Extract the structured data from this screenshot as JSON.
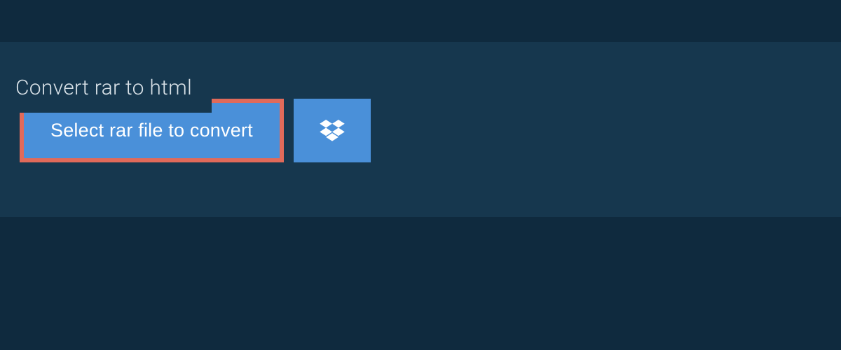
{
  "tab": {
    "title": "Convert rar to html"
  },
  "actions": {
    "select_label": "Select rar file to convert",
    "dropbox_icon_name": "dropbox-icon"
  },
  "colors": {
    "background_dark": "#0f2a3e",
    "background": "#16374e",
    "button": "#4a90d9",
    "button_border": "#e06a5a",
    "text_light": "#d9e2e8",
    "text_white": "#ffffff"
  }
}
